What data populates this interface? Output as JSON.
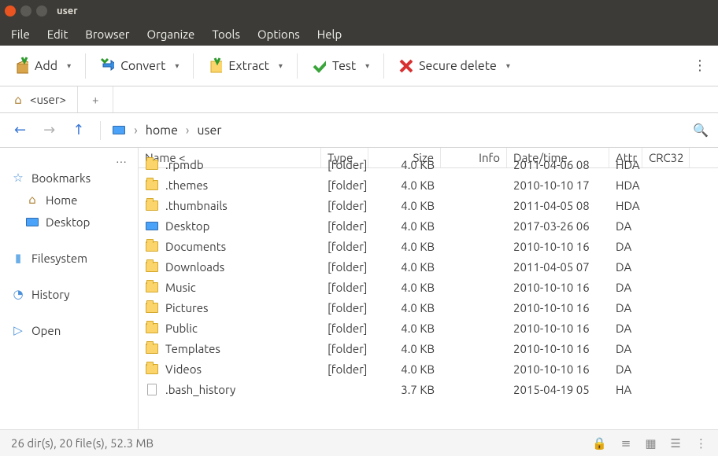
{
  "title": "user",
  "menu": [
    "File",
    "Edit",
    "Browser",
    "Organize",
    "Tools",
    "Options",
    "Help"
  ],
  "toolbar": {
    "add": "Add",
    "convert": "Convert",
    "extract": "Extract",
    "test": "Test",
    "secure_delete": "Secure delete"
  },
  "tabs": {
    "active": "<user>",
    "add": "+"
  },
  "nav": {
    "back": "←",
    "fwd": "→",
    "up": "↑"
  },
  "breadcrumb": [
    "home",
    "user"
  ],
  "sidebar": {
    "more": "…",
    "bookmarks": "Bookmarks",
    "home": "Home",
    "desktop": "Desktop",
    "filesystem": "Filesystem",
    "history": "History",
    "open": "Open"
  },
  "columns": {
    "name": "Name <",
    "type": "Type",
    "size": "Size",
    "info": "Info",
    "date": "Date/time",
    "attr": "Attr",
    "crc": "CRC32"
  },
  "files": [
    {
      "icon": "folder",
      "name": ".rpmdb",
      "type": "[folder]",
      "size": "4.0 KB",
      "date": "2011-04-06 08",
      "attr": "HDA"
    },
    {
      "icon": "folder",
      "name": ".themes",
      "type": "[folder]",
      "size": "4.0 KB",
      "date": "2010-10-10 17",
      "attr": "HDA"
    },
    {
      "icon": "folder",
      "name": ".thumbnails",
      "type": "[folder]",
      "size": "4.0 KB",
      "date": "2011-04-05 08",
      "attr": "HDA"
    },
    {
      "icon": "desktop",
      "name": "Desktop",
      "type": "[folder]",
      "size": "4.0 KB",
      "date": "2017-03-26 06",
      "attr": "DA"
    },
    {
      "icon": "folder",
      "name": "Documents",
      "type": "[folder]",
      "size": "4.0 KB",
      "date": "2010-10-10 16",
      "attr": "DA"
    },
    {
      "icon": "folder",
      "name": "Downloads",
      "type": "[folder]",
      "size": "4.0 KB",
      "date": "2011-04-05 07",
      "attr": "DA"
    },
    {
      "icon": "folder",
      "name": "Music",
      "type": "[folder]",
      "size": "4.0 KB",
      "date": "2010-10-10 16",
      "attr": "DA"
    },
    {
      "icon": "folder",
      "name": "Pictures",
      "type": "[folder]",
      "size": "4.0 KB",
      "date": "2010-10-10 16",
      "attr": "DA"
    },
    {
      "icon": "folder",
      "name": "Public",
      "type": "[folder]",
      "size": "4.0 KB",
      "date": "2010-10-10 16",
      "attr": "DA"
    },
    {
      "icon": "folder",
      "name": "Templates",
      "type": "[folder]",
      "size": "4.0 KB",
      "date": "2010-10-10 16",
      "attr": "DA"
    },
    {
      "icon": "folder",
      "name": "Videos",
      "type": "[folder]",
      "size": "4.0 KB",
      "date": "2010-10-10 16",
      "attr": "DA"
    },
    {
      "icon": "file",
      "name": ".bash_history",
      "type": "",
      "size": "3.7 KB",
      "date": "2015-04-19 05",
      "attr": "HA"
    }
  ],
  "status": {
    "summary": "26 dir(s), 20 file(s), 52.3 MB"
  }
}
